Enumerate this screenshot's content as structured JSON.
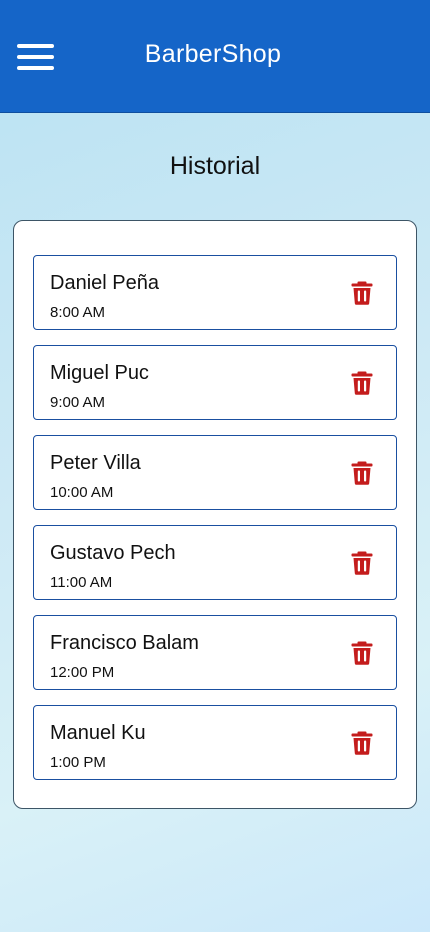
{
  "appbar": {
    "title": "BarberShop",
    "menu_icon": "hamburger-menu-icon",
    "background": "#1565c8"
  },
  "page": {
    "title": "Historial"
  },
  "appointments": [
    {
      "name": "Daniel Peña",
      "time": "8:00 AM",
      "action_icon": "trash-icon"
    },
    {
      "name": "Miguel Puc",
      "time": "9:00 AM",
      "action_icon": "trash-icon"
    },
    {
      "name": "Peter Villa",
      "time": "10:00 AM",
      "action_icon": "trash-icon"
    },
    {
      "name": "Gustavo Pech",
      "time": "11:00 AM",
      "action_icon": "trash-icon"
    },
    {
      "name": "Francisco Balam",
      "time": "12:00 PM",
      "action_icon": "trash-icon"
    },
    {
      "name": "Manuel Ku",
      "time": "1:00 PM",
      "action_icon": "trash-icon"
    }
  ],
  "colors": {
    "accent": "#1565c8",
    "delete": "#c41d1d",
    "item_border": "#1a4fa0"
  }
}
